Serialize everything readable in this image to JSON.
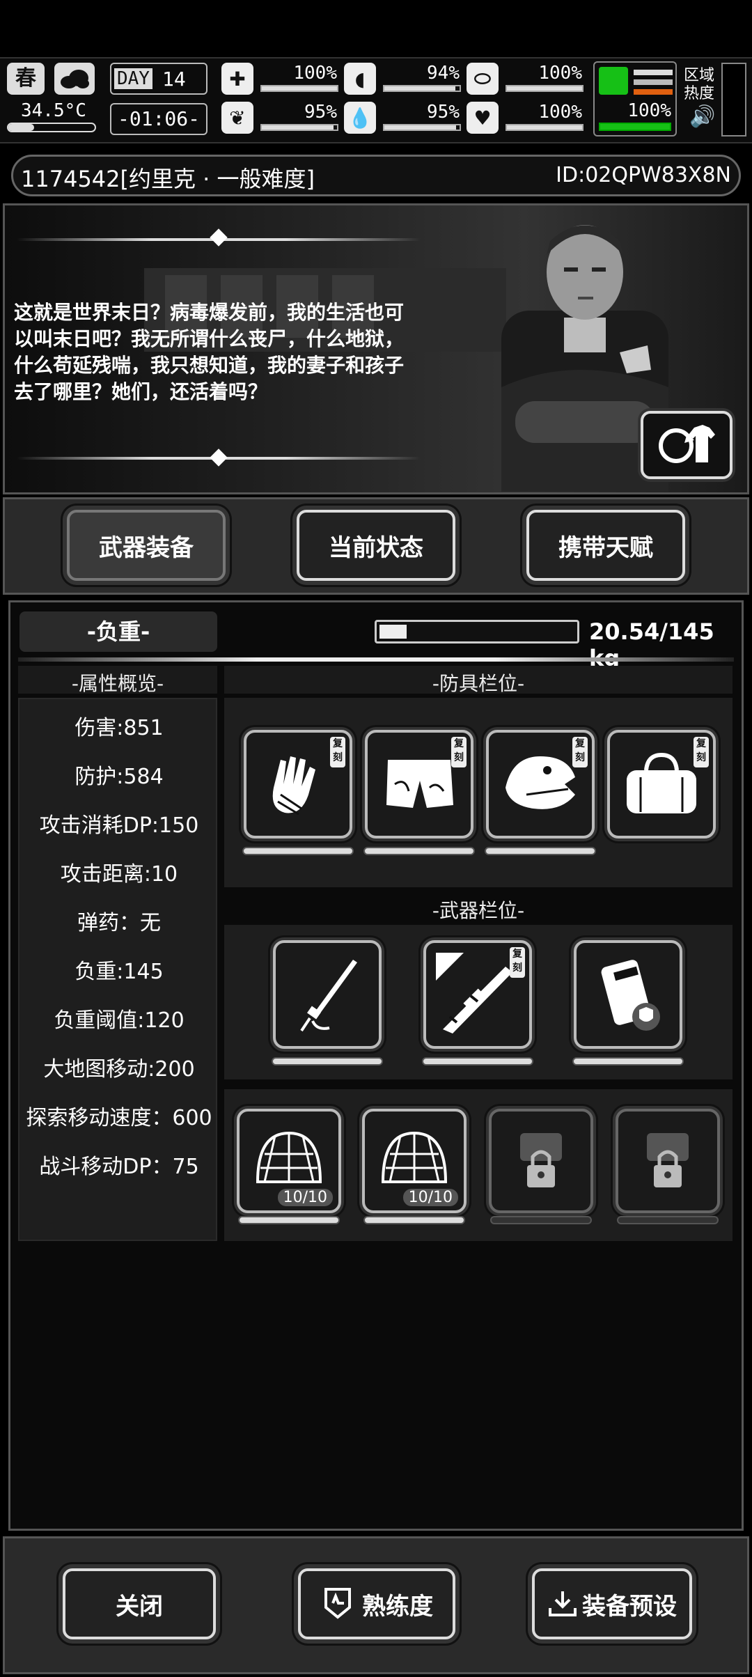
{
  "hud": {
    "season": "春",
    "temperature": "34.5°C",
    "day_label": "DAY",
    "day_number": "14",
    "clock": "-01:06-",
    "stats": [
      {
        "name": "medical",
        "value": "100%",
        "level": 1.0
      },
      {
        "name": "stomach",
        "value": "94%",
        "level": 0.94
      },
      {
        "name": "pill",
        "value": "100%",
        "level": 1.0
      },
      {
        "name": "brain",
        "value": "95%",
        "level": 0.95
      },
      {
        "name": "water",
        "value": "95%",
        "level": 0.95
      },
      {
        "name": "heart",
        "value": "100%",
        "level": 1.0
      }
    ],
    "stamina_value": "100%",
    "region_heat_label": "区域\n热度"
  },
  "character": {
    "title": "1174542[约里克 · 一般难度]",
    "id": "ID:02QPW83X8N",
    "quote": "这就是世界末日？病毒爆发前，我的生活也可以叫末日吧？我无所谓什么丧尸，什么地狱，什么苟延残喘，我只想知道，我的妻子和孩子去了哪里？她们，还活着吗？"
  },
  "tabs": [
    {
      "label": "武器装备",
      "selected": true
    },
    {
      "label": "当前状态",
      "selected": false
    },
    {
      "label": "携带天赋",
      "selected": false
    }
  ],
  "load": {
    "label": "-负重-",
    "value": "20.54/145 kg",
    "fraction": 0.14
  },
  "attributes": {
    "title": "-属性概览-",
    "items": [
      "伤害:851",
      "防护:584",
      "攻击消耗DP:150",
      "攻击距离:10",
      "弹药：无",
      "负重:145",
      "负重阈值:120",
      "大地图移动:200",
      "探索移动速度：600",
      "战斗移动DP：75"
    ]
  },
  "armor": {
    "title": "-防具栏位-",
    "slots": [
      {
        "icon": "gloves-icon",
        "tag": "复刻"
      },
      {
        "icon": "shorts-icon",
        "tag": "复刻"
      },
      {
        "icon": "dino-mask-icon",
        "tag": "复刻"
      },
      {
        "icon": "bag-icon",
        "tag": "复刻"
      }
    ]
  },
  "weapons": {
    "title": "-武器栏位-",
    "slots": [
      {
        "icon": "sword-icon",
        "tag": ""
      },
      {
        "icon": "rifle-icon",
        "tag": "复刻"
      },
      {
        "icon": "ammo-box-icon",
        "tag": ""
      }
    ]
  },
  "accessories": {
    "slots": [
      {
        "icon": "net-icon",
        "count": "10/10",
        "locked": false
      },
      {
        "icon": "net-icon",
        "count": "10/10",
        "locked": false
      },
      {
        "icon": "lock-icon",
        "count": "",
        "locked": true
      },
      {
        "icon": "lock-icon",
        "count": "",
        "locked": true
      }
    ]
  },
  "footer": {
    "close": "关闭",
    "proficiency": "熟练度",
    "preset": "装备预设"
  }
}
